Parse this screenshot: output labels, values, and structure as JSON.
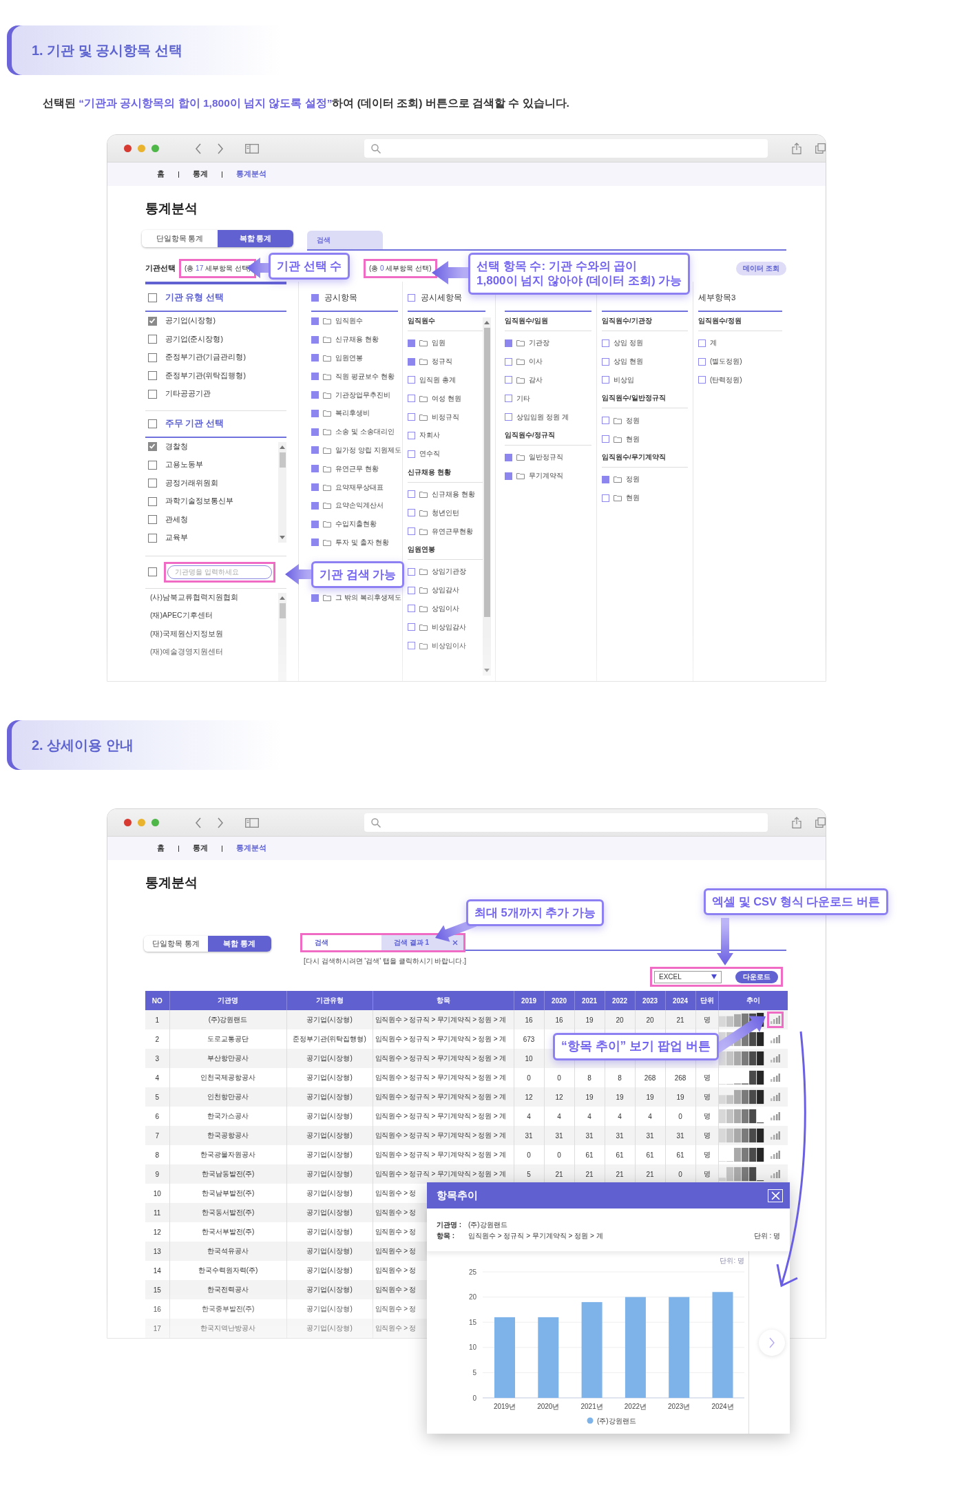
{
  "section_1": {
    "heading": "1. 기관 및 공시항목 선택",
    "description": "선택된 **“기관과 공시항목의 합이 1,800이 넘지 않도록 설정”**하여 (데이터 조회) 버튼으로 검색할 수 있습니다.",
    "breadcrumb": [
      {
        "label": "홈",
        "selected": false
      },
      {
        "label": "통계",
        "selected": false
      },
      {
        "label": "통계분석",
        "selected": true
      }
    ],
    "page_title": "통계분석",
    "mode_tabs": [
      {
        "label": "단일항목 통계",
        "selected": false
      },
      {
        "label": "복합 통계",
        "selected": true
      }
    ],
    "result_tabs": [
      {
        "label": "검색",
        "selected": true
      }
    ],
    "org_label": "기관선택",
    "org_count": "(총 **17** 세부항목 선택)",
    "item_count": "(총 **0** 세부항목 선택)",
    "query_button": "데이터 조회",
    "org_types": {
      "heading": "기관 유형 선택",
      "checked": false,
      "items": [
        {
          "label": "공기업(시장형)",
          "checked": true
        },
        {
          "label": "공기업(준시장형)",
          "checked": false
        },
        {
          "label": "준정부기관(기금관리형)",
          "checked": false
        },
        {
          "label": "준정부기관(위탁집행형)",
          "checked": false
        },
        {
          "label": "기타공공기관",
          "checked": false
        }
      ]
    },
    "ministries": {
      "heading": "주무 기관 선택",
      "checked": false,
      "items": [
        {
          "label": "경찰청",
          "checked": true
        },
        {
          "label": "고용노동부",
          "checked": false
        },
        {
          "label": "공정거래위원회",
          "checked": false
        },
        {
          "label": "과학기술정보통신부",
          "checked": false
        },
        {
          "label": "관세청",
          "checked": false
        },
        {
          "label": "교육부",
          "checked": false
        }
      ]
    },
    "org_search": {
      "checked": false,
      "placeholder": "기관명을 입력하세요"
    },
    "org_results": [
      "(사)남북교류협력지원협회",
      "(재)APEC기후센터",
      "(재)국제원산지정보원",
      "(재)예술경영지원센터"
    ],
    "columns": [
      {
        "heading": "공시항목",
        "checked": true,
        "groups": [
          {
            "items": [
              {
                "label": "임직원수",
                "checked": true,
                "folder": true
              },
              {
                "label": "신규채용 현황",
                "checked": true,
                "folder": true
              },
              {
                "label": "임원연봉",
                "checked": true,
                "folder": true
              },
              {
                "label": "직원 평균보수 현황",
                "checked": true,
                "folder": true
              },
              {
                "label": "기관장업무추진비",
                "checked": true,
                "folder": true
              },
              {
                "label": "복리후생비",
                "checked": true,
                "folder": true
              },
              {
                "label": "소송 및 소송대리인",
                "checked": true,
                "folder": true
              },
              {
                "label": "일가정 양립 지원제도",
                "checked": true,
                "folder": true
              },
              {
                "label": "유연근무 현황",
                "checked": true,
                "folder": true
              },
              {
                "label": "요약재무상태표",
                "checked": true,
                "folder": true
              },
              {
                "label": "요약손익계산서",
                "checked": true,
                "folder": true
              },
              {
                "label": "수입지출현황",
                "checked": true,
                "folder": true
              },
              {
                "label": "투자 및 출자 현황",
                "checked": true,
                "folder": true
              }
            ]
          },
          {
            "items": [
              {
                "label": "그 밖의 복리후생제도",
                "checked": true,
                "folder": true
              }
            ]
          }
        ]
      },
      {
        "heading": "공시세항목",
        "checked": false,
        "groups": [
          {
            "title": "임직원수",
            "items": [
              {
                "label": "임원",
                "checked": true,
                "folder": true
              },
              {
                "label": "정규직",
                "checked": true,
                "folder": true
              },
              {
                "label": "임직원 총계",
                "checked": false,
                "folder": false
              },
              {
                "label": "여성 현원",
                "checked": false,
                "folder": true
              },
              {
                "label": "비정규직",
                "checked": false,
                "folder": true
              },
              {
                "label": "자회사",
                "checked": false,
                "folder": false
              },
              {
                "label": "연수직",
                "checked": false,
                "folder": false
              }
            ]
          },
          {
            "title": "신규채용 현황",
            "items": [
              {
                "label": "신규채용 현황",
                "checked": false,
                "folder": true
              },
              {
                "label": "청년인턴",
                "checked": false,
                "folder": true
              },
              {
                "label": "유연근무현황",
                "checked": false,
                "folder": true
              }
            ]
          },
          {
            "title": "임원연봉",
            "items": [
              {
                "label": "상임기관장",
                "checked": false,
                "folder": true
              },
              {
                "label": "상임감사",
                "checked": false,
                "folder": true
              },
              {
                "label": "상임이사",
                "checked": false,
                "folder": true
              },
              {
                "label": "비상임감사",
                "checked": false,
                "folder": true
              },
              {
                "label": "비상임이사",
                "checked": false,
                "folder": true
              }
            ]
          }
        ]
      },
      {
        "groups": [
          {
            "title": "임직원수/임원",
            "items": [
              {
                "label": "기관장",
                "checked": true,
                "folder": true
              },
              {
                "label": "이사",
                "checked": false,
                "folder": true
              },
              {
                "label": "감사",
                "checked": false,
                "folder": true
              },
              {
                "label": "기타",
                "checked": false,
                "folder": false
              },
              {
                "label": "상임임원 정원 계",
                "checked": false,
                "folder": false
              }
            ]
          },
          {
            "title": "임직원수/정규직",
            "items": [
              {
                "label": "일반정규직",
                "checked": true,
                "folder": true
              },
              {
                "label": "무기계약직",
                "checked": true,
                "folder": true
              }
            ]
          }
        ]
      },
      {
        "groups": [
          {
            "title": "임직원수/기관장",
            "items": [
              {
                "label": "상임 정원",
                "checked": false,
                "folder": false
              },
              {
                "label": "상임 현원",
                "checked": false,
                "folder": false
              },
              {
                "label": "비상임",
                "checked": false,
                "folder": false
              }
            ]
          },
          {
            "title": "임직원수/일반정규직",
            "items": [
              {
                "label": "정원",
                "checked": false,
                "folder": true
              },
              {
                "label": "현원",
                "checked": false,
                "folder": true
              }
            ]
          },
          {
            "title": "임직원수/무기계약직",
            "items": [
              {
                "label": "정원",
                "checked": true,
                "folder": true
              },
              {
                "label": "현원",
                "checked": false,
                "folder": true
              }
            ]
          }
        ]
      },
      {
        "heading": "세부항목3",
        "groups": [
          {
            "title": "임직원수/정원",
            "items": [
              {
                "label": "계",
                "checked": false,
                "folder": false
              },
              {
                "label": "(별도정원)",
                "checked": false,
                "folder": false
              },
              {
                "label": "(탄력정원)",
                "checked": false,
                "folder": false
              }
            ]
          }
        ]
      }
    ],
    "callouts": [
      {
        "lines": [
          "기관 선택 수"
        ]
      },
      {
        "lines": [
          "선택 항목 수: 기관 수와의 곱이",
          "1,800이 넘지 않아야 (데이터 조회) 가능"
        ]
      },
      {
        "lines": [
          "기관 검색 가능"
        ]
      }
    ]
  },
  "section_2": {
    "heading": "2. 상세이용 안내",
    "breadcrumb": [
      {
        "label": "홈",
        "selected": false
      },
      {
        "label": "통계",
        "selected": false
      },
      {
        "label": "통계분석",
        "selected": true
      }
    ],
    "page_title": "통계분석",
    "mode_tabs": [
      {
        "label": "단일항목 통계",
        "selected": false
      },
      {
        "label": "복합 통계",
        "selected": true
      }
    ],
    "result_tabs": [
      {
        "label": "검색",
        "selected": false,
        "closable": false
      },
      {
        "label": "검색 결과 1",
        "selected": true,
        "closable": true
      }
    ],
    "notice": "[다시 검색하시려면 '검색' 탭을 클릭하시기 바랍니다.]",
    "export_format": "EXCEL",
    "download_button": "다운로드",
    "table": {
      "columns": [
        "NO",
        "기관명",
        "기관유형",
        "항목",
        "2019",
        "2020",
        "2021",
        "2022",
        "2023",
        "2024",
        "단위",
        "추이"
      ],
      "rows": [
        {
          "no": "1",
          "org": "(주)강원랜드",
          "type": "공기업(시장형)",
          "item": "임직원수 > 정규직 > 무기계약직 > 정원 > 계",
          "values": [
            "16",
            "16",
            "19",
            "20",
            "20",
            "21"
          ],
          "unit": "명",
          "trend": true,
          "highlighted": true
        },
        {
          "no": "2",
          "org": "도로교통공단",
          "type": "준정부기관(위탁집행형)",
          "item": "임직원수 > 정규직 > 무기계약직 > 정원 > 계",
          "values": [
            "673"
          ],
          "trend": true,
          "highlighted": false
        },
        {
          "no": "3",
          "org": "부산항만공사",
          "type": "공기업(시장형)",
          "item": "임직원수 > 정규직 > 무기계약직 > 정원 > 계",
          "values": [
            "10"
          ],
          "trend": true,
          "highlighted": false
        },
        {
          "no": "4",
          "org": "인천국제공항공사",
          "type": "공기업(시장형)",
          "item": "임직원수 > 정규직 > 무기계약직 > 정원 > 계",
          "values": [
            "0",
            "0",
            "8",
            "8",
            "268",
            "268"
          ],
          "unit": "명",
          "trend": true,
          "highlighted": false
        },
        {
          "no": "5",
          "org": "인천항만공사",
          "type": "공기업(시장형)",
          "item": "임직원수 > 정규직 > 무기계약직 > 정원 > 계",
          "values": [
            "12",
            "12",
            "19",
            "19",
            "19",
            "19"
          ],
          "unit": "명",
          "trend": true,
          "highlighted": false
        },
        {
          "no": "6",
          "org": "한국가스공사",
          "type": "공기업(시장형)",
          "item": "임직원수 > 정규직 > 무기계약직 > 정원 > 계",
          "values": [
            "4",
            "4",
            "4",
            "4",
            "4",
            "0"
          ],
          "unit": "명",
          "trend": true,
          "highlighted": false
        },
        {
          "no": "7",
          "org": "한국공항공사",
          "type": "공기업(시장형)",
          "item": "임직원수 > 정규직 > 무기계약직 > 정원 > 계",
          "values": [
            "31",
            "31",
            "31",
            "31",
            "31",
            "31"
          ],
          "unit": "명",
          "trend": true,
          "highlighted": false
        },
        {
          "no": "8",
          "org": "한국광물자원공사",
          "type": "공기업(시장형)",
          "item": "임직원수 > 정규직 > 무기계약직 > 정원 > 계",
          "values": [
            "0",
            "0",
            "61",
            "61",
            "61",
            "61"
          ],
          "unit": "명",
          "trend": true,
          "highlighted": false
        },
        {
          "no": "9",
          "org": "한국남동발전(주)",
          "type": "공기업(시장형)",
          "item": "임직원수 > 정규직 > 무기계약직 > 정원 > 계",
          "values": [
            "5",
            "21",
            "21",
            "21",
            "21",
            "0"
          ],
          "unit": "명",
          "trend": true,
          "highlighted": false
        },
        {
          "no": "10",
          "org": "한국남부발전(주)",
          "type": "공기업(시장형)",
          "item": "임직원수 > 정"
        },
        {
          "no": "11",
          "org": "한국동서발전(주)",
          "type": "공기업(시장형)",
          "item": "임직원수 > 정"
        },
        {
          "no": "12",
          "org": "한국서부발전(주)",
          "type": "공기업(시장형)",
          "item": "임직원수 > 정"
        },
        {
          "no": "13",
          "org": "한국석유공사",
          "type": "공기업(시장형)",
          "item": "임직원수 > 정"
        },
        {
          "no": "14",
          "org": "한국수력원자력(주)",
          "type": "공기업(시장형)",
          "item": "임직원수 > 정"
        },
        {
          "no": "15",
          "org": "한국전력공사",
          "type": "공기업(시장형)",
          "item": "임직원수 > 정"
        },
        {
          "no": "16",
          "org": "한국중부발전(주)",
          "type": "공기업(시장형)",
          "item": "임직원수 > 정"
        },
        {
          "no": "17",
          "org": "한국지역난방공사",
          "type": "공기업(시장형)",
          "item": "임직원수 > 정"
        }
      ]
    },
    "popup": {
      "title": "항목추이",
      "org_label": "기관명 :",
      "org": "(주)강원랜드",
      "item_label": "항목 :",
      "item": "임직원수 > 정규직 > 무기계약직 > 정원 > 계",
      "unit": "단위 : 명",
      "chart_unit": "단위: 명",
      "chart_data": {
        "type": "bar",
        "categories": [
          "2019년",
          "2020년",
          "2021년",
          "2022년",
          "2023년",
          "2024년"
        ],
        "series": [
          {
            "name": "(주)강원랜드",
            "color": "#7db3e8",
            "values": [
              16,
              16,
              19,
              20,
              20,
              21
            ]
          }
        ],
        "ylim": [
          0,
          25
        ],
        "yticks": [
          0,
          5,
          10,
          15,
          20,
          25
        ],
        "grid": true
      }
    },
    "callouts": [
      {
        "lines": [
          "최대 5개까지 추가 가능"
        ]
      },
      {
        "lines": [
          "엑셀 및 CSV 형식 다운로드 버튼"
        ]
      },
      {
        "lines": [
          "“항목 추이” 보기 팝업 버튼"
        ]
      }
    ]
  }
}
